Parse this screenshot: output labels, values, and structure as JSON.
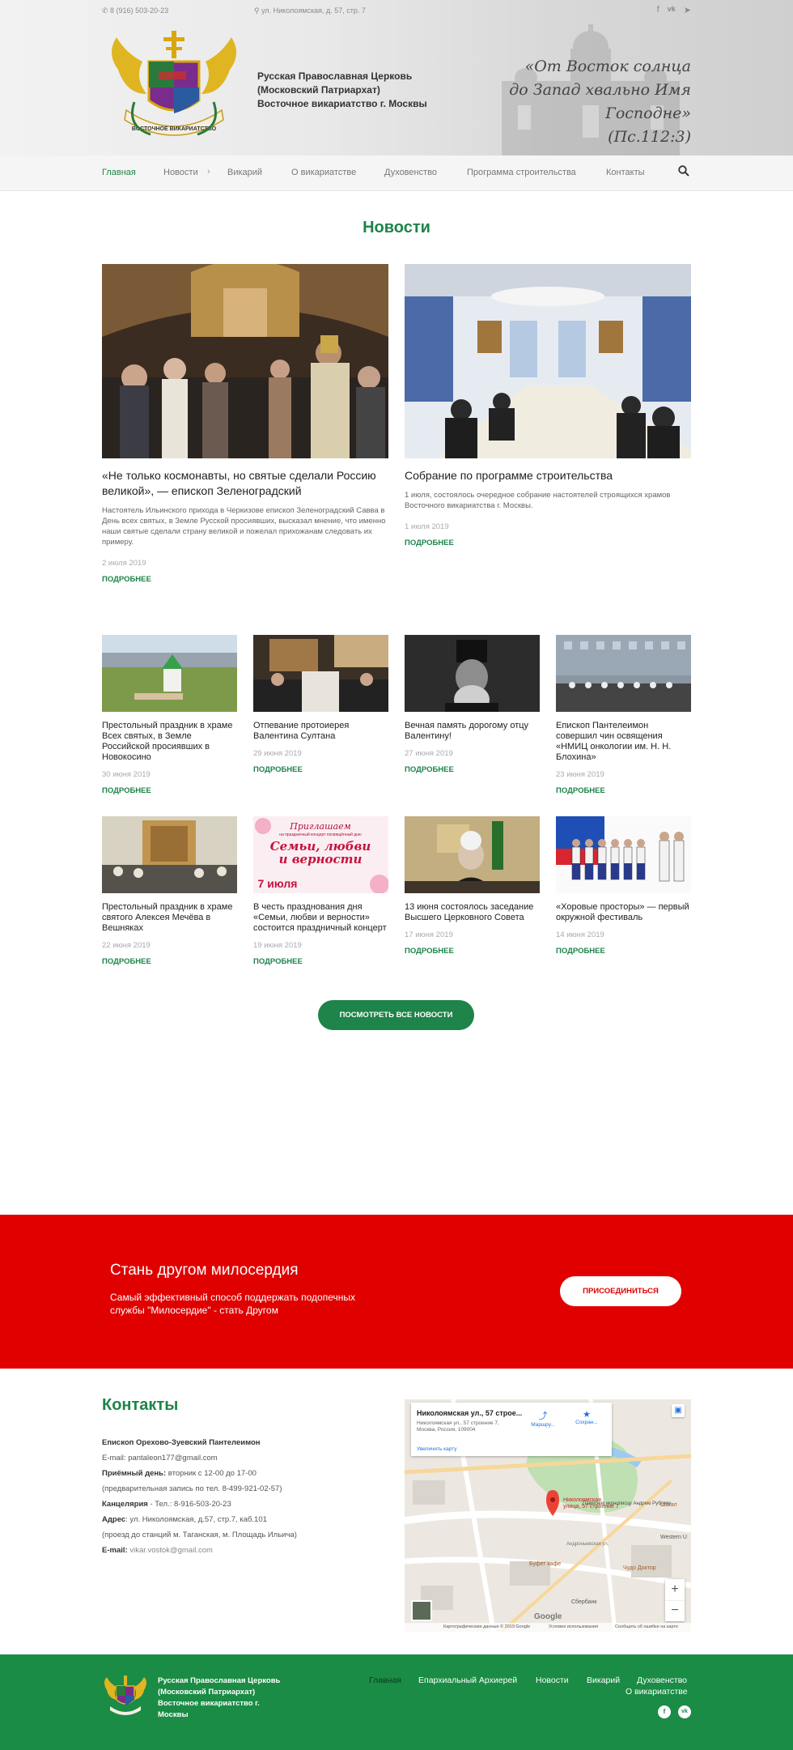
{
  "header": {
    "phone": "8 (916) 503-20-23",
    "address": "ул. Николоямская, д. 57, стр. 7",
    "org_line1": "Русская Православная Церковь",
    "org_line2": "(Московский Патриархат)",
    "org_line3": "Восточное викариатство г. Москвы",
    "motto_line1": "«От Восток солнца",
    "motto_line2": "до Запад хвально Имя Господне»",
    "motto_line3": "(Пс.112:3)",
    "logo_ribbon": "ВОСТОЧНОЕ ВИКАРИАТСТВО",
    "socials": [
      "facebook-icon",
      "vk-icon",
      "telegram-icon"
    ]
  },
  "nav": {
    "items": [
      "Главная",
      "Новости",
      "Викарий",
      "О викариатстве",
      "Духовенство",
      "Программа строительства",
      "Контакты"
    ],
    "active": "Главная"
  },
  "news": {
    "title": "Новости",
    "more_label": "ПОДРОБНЕЕ",
    "featured": [
      {
        "title": "«Не только космонавты, но святые сделали Россию великой», — епископ Зеленоградский",
        "desc": "Настоятель Ильинского прихода в Черкизове епископ Зеленоградский Савва в День всех святых, в Земле Русской просиявших, высказал мнение, что именно наши святые сделали страну великой и пожелал прихожанам следовать их примеру.",
        "date": "2 июля 2019"
      },
      {
        "title": "Собрание по программе строительства",
        "desc": "1 июля, состоялось очередное собрание настоятелей строящихся храмов Восточного викариатства г. Москвы.",
        "date": "1 июля 2019"
      }
    ],
    "row1": [
      {
        "title": "Престольный праздник в храме Всех святых, в Земле Российской просиявших в Новокосино",
        "date": "30 июня 2019"
      },
      {
        "title": "Отпевание протоиерея Валентина Султана",
        "date": "29 июня 2019"
      },
      {
        "title": "Вечная память дорогому отцу Валентину!",
        "date": "27 июня 2019"
      },
      {
        "title": "Епископ Пантелеимон совершил чин освящения «НМИЦ онкологии им. Н. Н. Блохина»",
        "date": "23 июня 2019"
      }
    ],
    "row2": [
      {
        "title": "Престольный праздник в храме святого Алексея Мечёва в Вешняках",
        "date": "22 июня 2019"
      },
      {
        "title": "В честь празднования дня «Семьи, любви и верности» состоится праздничный концерт",
        "date": "19 июня 2019"
      },
      {
        "title": "13 июня состоялось заседание Высшего Церковного Совета",
        "date": "17 июня 2019"
      },
      {
        "title": "«Хоровые просторы» — первый окружной фестиваль",
        "date": "14 июня 2019"
      }
    ],
    "poster_line1": "Приглашаем",
    "poster_line2": "на праздничный концерт посвящённый дню",
    "poster_line3": "Семьи, любви",
    "poster_line4": "и верности",
    "poster_date": "7 июля",
    "all_button": "ПОСМОТРЕТЬ ВСЕ НОВОСТИ"
  },
  "banner": {
    "title": "Стань другом милосердия",
    "subtitle": "Самый эффективный способ поддержать подопечных службы \"Милосердие\" - стать Другом",
    "button": "ПРИСОЕДИНИТЬСЯ"
  },
  "contacts": {
    "title": "Контакты",
    "bishop": "Епископ Орехово-Зуевский Пантелеимон",
    "email_line": "E-mail: pantaleon177@gmail.com",
    "reception_label": "Приёмный день:",
    "reception_value": " вторник с 12-00 до 17-00",
    "preregistration": "(предварительная запись по тел. 8-499-921-02-57)",
    "office_label": "Канцелярия",
    "office_value": " - Тел.: 8-916-503-20-23",
    "address_label": "Адрес",
    "address_value": ": ул. Николоямская, д.57, стр.7, каб.101",
    "directions": "(проезд до станций м. Таганская, м. Площадь Ильича)",
    "email2_label": "E-mail:",
    "email2_value": "vikar.vostok@gmail.com"
  },
  "map": {
    "place_title": "Николоямская ул., 57 строе...",
    "place_addr1": "Николоямская ул., 57 строение 7,",
    "place_addr2": "Москва, Россия, 109004",
    "route_label": "Маршру...",
    "save_label": "Сохран...",
    "enlarge_label": "Увеличить карту",
    "pin_label1": "Николоямская",
    "pin_label2": "улица, 57 строение 7",
    "labels": [
      "Памятник иконописцу Андрею Рублеву",
      "Буфет кафе",
      "Чудо Доктор",
      "Шагал",
      "Western U",
      "Сбербанк",
      "Андроньевская ул."
    ],
    "zoom_in": "+",
    "zoom_out": "−",
    "footer_data": "Картографические данные © 2019 Google",
    "footer_terms": "Условия использования",
    "footer_report": "Сообщить об ошибке на карте",
    "google": "Google"
  },
  "footer": {
    "org_line1": "Русская Православная Церковь",
    "org_line2": "(Московский Патриархат)",
    "org_line3": "Восточное викариатство г.",
    "org_line4": "Москвы",
    "nav": [
      "Главная",
      "Епархиальный Архиерей",
      "Новости",
      "Викарий",
      "Духовенство",
      "О викариатстве"
    ],
    "active": "Главная"
  },
  "colors": {
    "green": "#1e8449",
    "red": "#e00000",
    "footer_green": "#1a8c45"
  }
}
